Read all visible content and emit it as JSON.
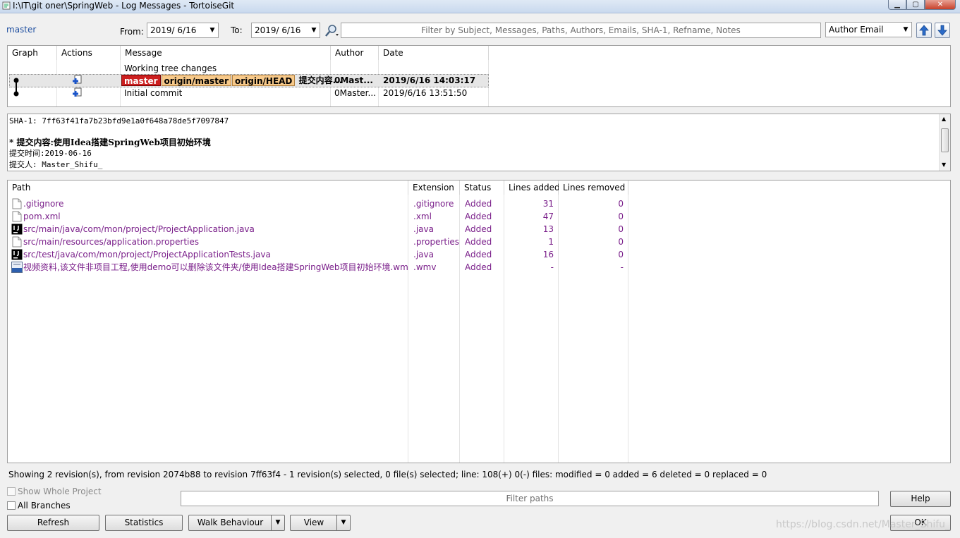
{
  "window": {
    "title": "I:\\IT\\git oner\\SpringWeb - Log Messages - TortoiseGit",
    "min_glyph": "▁",
    "max_glyph": "▢",
    "close_glyph": "✕"
  },
  "toolbar": {
    "branch": "master",
    "from_label": "From:",
    "from_value": "2019/  6/16",
    "to_label": "To:",
    "to_value": "2019/  6/16",
    "filter_placeholder": "Filter by Subject, Messages, Paths, Authors, Emails, SHA-1, Refname, Notes",
    "filter_field": "Author Email"
  },
  "log": {
    "columns": [
      "Graph",
      "Actions",
      "Message",
      "Author",
      "Date"
    ],
    "working_tree": "Working tree changes",
    "rows": [
      {
        "tags_local": [
          "master"
        ],
        "tags_remote": [
          "origin/master",
          "origin/HEAD"
        ],
        "message": "提交内容...",
        "author": "0Mast...",
        "date": "2019/6/16 14:03:17"
      },
      {
        "tags_local": [],
        "tags_remote": [],
        "message": "Initial commit",
        "author": "0Master...",
        "date": "2019/6/16 13:51:50"
      }
    ]
  },
  "detail": {
    "sha": "SHA-1: 7ff63f41fa7b23bfd9e1a0f648a78de5f7097847",
    "subject": "* 提交内容:使用Idea搭建SpringWeb项目初始环境",
    "line_time": "提交时间:2019-06-16",
    "line_author": "提交人: Master_Shifu_"
  },
  "files": {
    "columns": [
      "Path",
      "Extension",
      "Status",
      "Lines added",
      "Lines removed"
    ],
    "rows": [
      {
        "icon": "file-icon",
        "path": ".gitignore",
        "ext": ".gitignore",
        "status": "Added",
        "added": "31",
        "removed": "0"
      },
      {
        "icon": "file-icon",
        "path": "pom.xml",
        "ext": ".xml",
        "status": "Added",
        "added": "47",
        "removed": "0"
      },
      {
        "icon": "intellij-icon",
        "path": "src/main/java/com/mon/project/ProjectApplication.java",
        "ext": ".java",
        "status": "Added",
        "added": "13",
        "removed": "0"
      },
      {
        "icon": "file-icon",
        "path": "src/main/resources/application.properties",
        "ext": ".properties",
        "status": "Added",
        "added": "1",
        "removed": "0"
      },
      {
        "icon": "intellij-icon",
        "path": "src/test/java/com/mon/project/ProjectApplicationTests.java",
        "ext": ".java",
        "status": "Added",
        "added": "16",
        "removed": "0"
      },
      {
        "icon": "wmv-icon",
        "path": "视频资料,该文件非项目工程,使用demo可以删除该文件夹/使用Idea搭建SpringWeb项目初始环境.wmv",
        "ext": ".wmv",
        "status": "Added",
        "added": "-",
        "removed": "-"
      }
    ]
  },
  "status_bar": "Showing 2 revision(s), from revision 2074b88 to revision 7ff63f4 - 1 revision(s) selected, 0 file(s) selected; line: 108(+) 0(-) files: modified = 0 added = 6 deleted = 0 replaced = 0",
  "bottom": {
    "show_whole_project": "Show Whole Project",
    "all_branches": "All Branches",
    "filter_paths_placeholder": "Filter paths",
    "help": "Help",
    "refresh": "Refresh",
    "statistics": "Statistics",
    "walk_behaviour": "Walk Behaviour",
    "view": "View",
    "ok": "OK",
    "watermark": "https://blog.csdn.net/Master_Shifu_"
  },
  "colors": {
    "local_branch": "#cc1f1f",
    "remote_branch": "#f7c98a",
    "status_added": "#7a1f8a",
    "link": "#1f4fa0"
  }
}
